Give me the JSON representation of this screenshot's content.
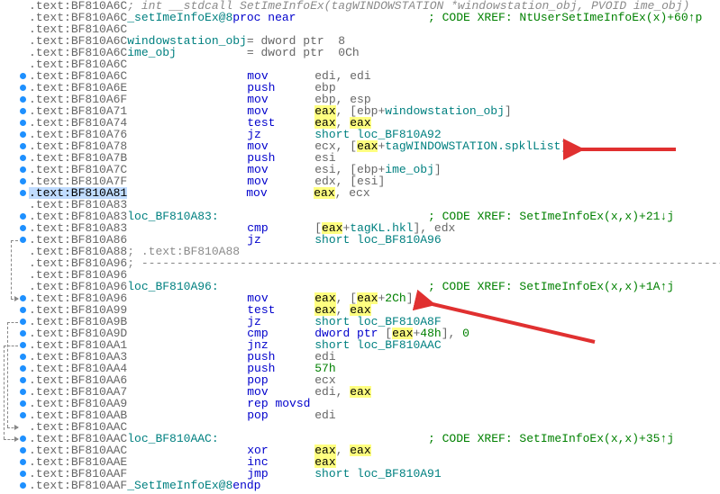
{
  "base_addr_prefix": ".text:",
  "lines": [
    {
      "addr": "BF810A6C",
      "type": "sig",
      "text": "; int __stdcall SetImeInfoEx(tagWINDOWSTATION *windowstation_obj, PVOID ime_obj)"
    },
    {
      "addr": "BF810A6C",
      "type": "proc",
      "fn": "_setImeInfoEx@8",
      "kw": "proc near",
      "xref": "; CODE XREF: NtUserSetImeInfoEx(x)+60↑p"
    },
    {
      "addr": "BF810A6C",
      "type": "blank"
    },
    {
      "addr": "BF810A6C",
      "type": "argdef",
      "name": "windowstation_obj",
      "def": "= dword ptr  8"
    },
    {
      "addr": "BF810A6C",
      "type": "argdef",
      "name": "ime_obj",
      "def": "= dword ptr  0Ch",
      "pad_name": "ime_obj          "
    },
    {
      "addr": "BF810A6C",
      "type": "blank"
    },
    {
      "addr": "BF810A6C",
      "type": "ins",
      "op": "mov",
      "args": [
        {
          "t": "reg",
          "v": "edi"
        },
        {
          "t": "reg",
          "v": "edi"
        }
      ]
    },
    {
      "addr": "BF810A6E",
      "type": "ins",
      "op": "push",
      "args": [
        {
          "t": "reg",
          "v": "ebp"
        }
      ]
    },
    {
      "addr": "BF810A6F",
      "type": "ins",
      "op": "mov",
      "args": [
        {
          "t": "reg",
          "v": "ebp"
        },
        {
          "t": "reg",
          "v": "esp"
        }
      ]
    },
    {
      "addr": "BF810A71",
      "type": "ins",
      "op": "mov",
      "args": [
        {
          "t": "hi",
          "v": "eax"
        },
        {
          "t": "mem",
          "pre": "[ebp+",
          "ref": "windowstation_obj",
          "post": "]"
        }
      ]
    },
    {
      "addr": "BF810A74",
      "type": "ins",
      "op": "test",
      "args": [
        {
          "t": "hi",
          "v": "eax"
        },
        {
          "t": "hi",
          "v": "eax"
        }
      ]
    },
    {
      "addr": "BF810A76",
      "type": "ins",
      "op": "jz",
      "args": [
        {
          "t": "loc",
          "v": "short loc_BF810A92"
        }
      ]
    },
    {
      "addr": "BF810A78",
      "type": "ins",
      "op": "mov",
      "args": [
        {
          "t": "reg",
          "v": "ecx"
        },
        {
          "t": "memstruct",
          "pre": "[",
          "hi": "eax",
          "post": "+",
          "struct": "tagWINDOWSTATION.spklList",
          "end": "]"
        }
      ],
      "arrow1": true
    },
    {
      "addr": "BF810A7B",
      "type": "ins",
      "op": "push",
      "args": [
        {
          "t": "reg",
          "v": "esi"
        }
      ]
    },
    {
      "addr": "BF810A7C",
      "type": "ins",
      "op": "mov",
      "args": [
        {
          "t": "reg",
          "v": "esi"
        },
        {
          "t": "mem",
          "pre": "[ebp+",
          "ref": "ime_obj",
          "post": "]"
        }
      ]
    },
    {
      "addr": "BF810A7F",
      "type": "ins",
      "op": "mov",
      "args": [
        {
          "t": "reg",
          "v": "edx"
        },
        {
          "t": "txt",
          "v": "[esi]"
        }
      ]
    },
    {
      "addr": "BF810A81",
      "type": "ins",
      "op": "mov",
      "args": [
        {
          "t": "hi",
          "v": "eax"
        },
        {
          "t": "reg",
          "v": "ecx"
        }
      ],
      "sel": true
    },
    {
      "addr": "BF810A83",
      "type": "blank"
    },
    {
      "addr": "BF810A83",
      "type": "label",
      "name": "loc_BF810A83:",
      "xref": "; CODE XREF: SetImeInfoEx(x,x)+21↓j"
    },
    {
      "addr": "BF810A83",
      "type": "ins",
      "op": "cmp",
      "args": [
        {
          "t": "memstruct",
          "pre": "[",
          "hi": "eax",
          "post": "+",
          "struct": "tagKL.hkl",
          "end": "]"
        },
        {
          "t": "reg",
          "v": "edx"
        }
      ]
    },
    {
      "addr": "BF810A86",
      "type": "ins",
      "op": "jz",
      "args": [
        {
          "t": "loc",
          "v": "short loc_BF810A96"
        }
      ]
    },
    {
      "addr": "BF810A88",
      "type": "cmt",
      "text": "; .text:BF810A88"
    },
    {
      "addr": "BF810A96",
      "type": "dash"
    },
    {
      "addr": "BF810A96",
      "type": "blank"
    },
    {
      "addr": "BF810A96",
      "type": "label",
      "name": "loc_BF810A96:",
      "xref": "; CODE XREF: SetImeInfoEx(x,x)+1A↑j"
    },
    {
      "addr": "BF810A96",
      "type": "ins",
      "op": "mov",
      "args": [
        {
          "t": "hi",
          "v": "eax"
        },
        {
          "t": "memnum",
          "pre": "[",
          "hi": "eax",
          "mid": "+",
          "num": "2Ch",
          "end": "]"
        }
      ],
      "arrow2": true
    },
    {
      "addr": "BF810A99",
      "type": "ins",
      "op": "test",
      "args": [
        {
          "t": "hi",
          "v": "eax"
        },
        {
          "t": "hi",
          "v": "eax"
        }
      ]
    },
    {
      "addr": "BF810A9B",
      "type": "ins",
      "op": "jz",
      "args": [
        {
          "t": "loc",
          "v": "short loc_BF810A8F"
        }
      ]
    },
    {
      "addr": "BF810A9D",
      "type": "ins",
      "op": "cmp",
      "args": [
        {
          "t": "dwordnum",
          "pre": "dword ptr [",
          "hi": "eax",
          "mid": "+",
          "num": "48h",
          "end": "]"
        },
        {
          "t": "num",
          "v": "0"
        }
      ]
    },
    {
      "addr": "BF810AA1",
      "type": "ins",
      "op": "jnz",
      "args": [
        {
          "t": "loc",
          "v": "short loc_BF810AAC"
        }
      ]
    },
    {
      "addr": "BF810AA3",
      "type": "ins",
      "op": "push",
      "args": [
        {
          "t": "reg",
          "v": "edi"
        }
      ]
    },
    {
      "addr": "BF810AA4",
      "type": "ins",
      "op": "push",
      "args": [
        {
          "t": "num",
          "v": "57h"
        }
      ]
    },
    {
      "addr": "BF810AA6",
      "type": "ins",
      "op": "pop",
      "args": [
        {
          "t": "reg",
          "v": "ecx"
        }
      ]
    },
    {
      "addr": "BF810AA7",
      "type": "ins",
      "op": "mov",
      "args": [
        {
          "t": "reg",
          "v": "edi"
        },
        {
          "t": "hi",
          "v": "eax"
        }
      ]
    },
    {
      "addr": "BF810AA9",
      "type": "ins",
      "op": "rep movsd",
      "args": []
    },
    {
      "addr": "BF810AAB",
      "type": "ins",
      "op": "pop",
      "args": [
        {
          "t": "reg",
          "v": "edi"
        }
      ]
    },
    {
      "addr": "BF810AAC",
      "type": "blank"
    },
    {
      "addr": "BF810AAC",
      "type": "label",
      "name": "loc_BF810AAC:",
      "xref": "; CODE XREF: SetImeInfoEx(x,x)+35↑j"
    },
    {
      "addr": "BF810AAC",
      "type": "ins",
      "op": "xor",
      "args": [
        {
          "t": "hi",
          "v": "eax"
        },
        {
          "t": "hi",
          "v": "eax"
        }
      ]
    },
    {
      "addr": "BF810AAE",
      "type": "ins",
      "op": "inc",
      "args": [
        {
          "t": "hi",
          "v": "eax"
        }
      ]
    },
    {
      "addr": "BF810AAF",
      "type": "ins",
      "op": "jmp",
      "args": [
        {
          "t": "loc",
          "v": "short loc_BF810A91"
        }
      ]
    },
    {
      "addr": "BF810AAF",
      "type": "endp",
      "fn": "_SetImeInfoEx@8",
      "kw": "endp"
    }
  ],
  "dots_rows": [
    6,
    7,
    8,
    9,
    10,
    11,
    12,
    13,
    14,
    15,
    16,
    18,
    19,
    20,
    25,
    26,
    27,
    28,
    29,
    30,
    31,
    32,
    33,
    34,
    35,
    37,
    38,
    39,
    40,
    41
  ],
  "flows": [
    {
      "from": 20,
      "to": 25,
      "x": 12
    },
    {
      "from": 27,
      "to": 36,
      "x": 8
    },
    {
      "from": 29,
      "to": 37,
      "x": 4
    }
  ],
  "annotations": {
    "arrow1_target_row": 12,
    "arrow2_target_row": 25
  }
}
